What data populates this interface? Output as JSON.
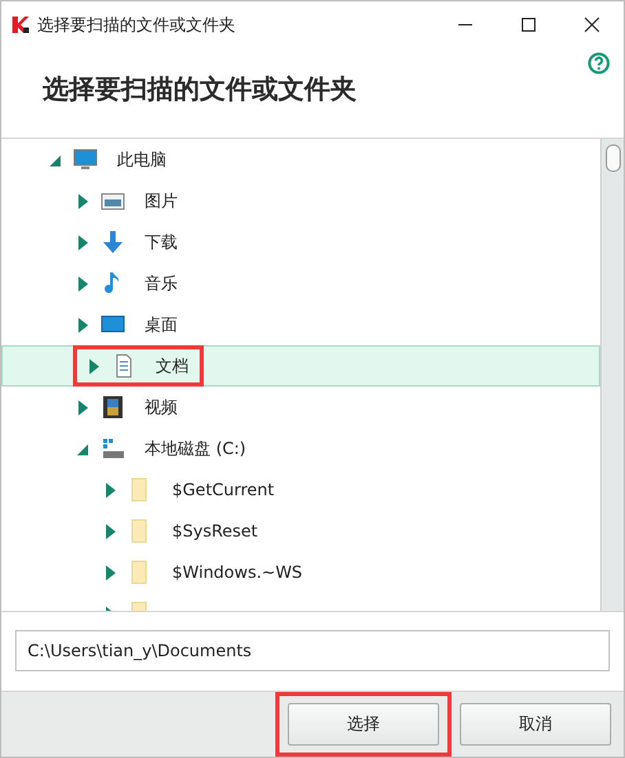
{
  "window": {
    "title": "选择要扫描的文件或文件夹"
  },
  "heading": "选择要扫描的文件或文件夹",
  "tree": [
    {
      "label": "此电脑",
      "kind": "computer",
      "expanded": true,
      "selected": false,
      "annotated": false,
      "children": [
        {
          "label": "图片",
          "kind": "pictures",
          "expanded": false,
          "selected": false,
          "annotated": false
        },
        {
          "label": "下载",
          "kind": "downloads",
          "expanded": false,
          "selected": false,
          "annotated": false
        },
        {
          "label": "音乐",
          "kind": "music",
          "expanded": false,
          "selected": false,
          "annotated": false
        },
        {
          "label": "桌面",
          "kind": "desktop",
          "expanded": false,
          "selected": false,
          "annotated": false
        },
        {
          "label": "文档",
          "kind": "documents",
          "expanded": false,
          "selected": true,
          "annotated": true
        },
        {
          "label": "视频",
          "kind": "videos",
          "expanded": false,
          "selected": false,
          "annotated": false
        },
        {
          "label": "本地磁盘 (C:)",
          "kind": "drive",
          "expanded": true,
          "selected": false,
          "annotated": false,
          "children": [
            {
              "label": "$GetCurrent",
              "kind": "folder",
              "expanded": false,
              "selected": false,
              "annotated": false
            },
            {
              "label": "$SysReset",
              "kind": "folder",
              "expanded": false,
              "selected": false,
              "annotated": false
            },
            {
              "label": "$Windows.~WS",
              "kind": "folder",
              "expanded": false,
              "selected": false,
              "annotated": false
            },
            {
              "kind": "folder",
              "expanded": false,
              "selected": false,
              "annotated": false
            }
          ]
        }
      ]
    }
  ],
  "path_field": {
    "value": "C:\\Users\\tian_y\\Documents"
  },
  "buttons": [
    {
      "label": "选择",
      "annotated": true
    },
    {
      "label": "取消",
      "annotated": false
    }
  ]
}
